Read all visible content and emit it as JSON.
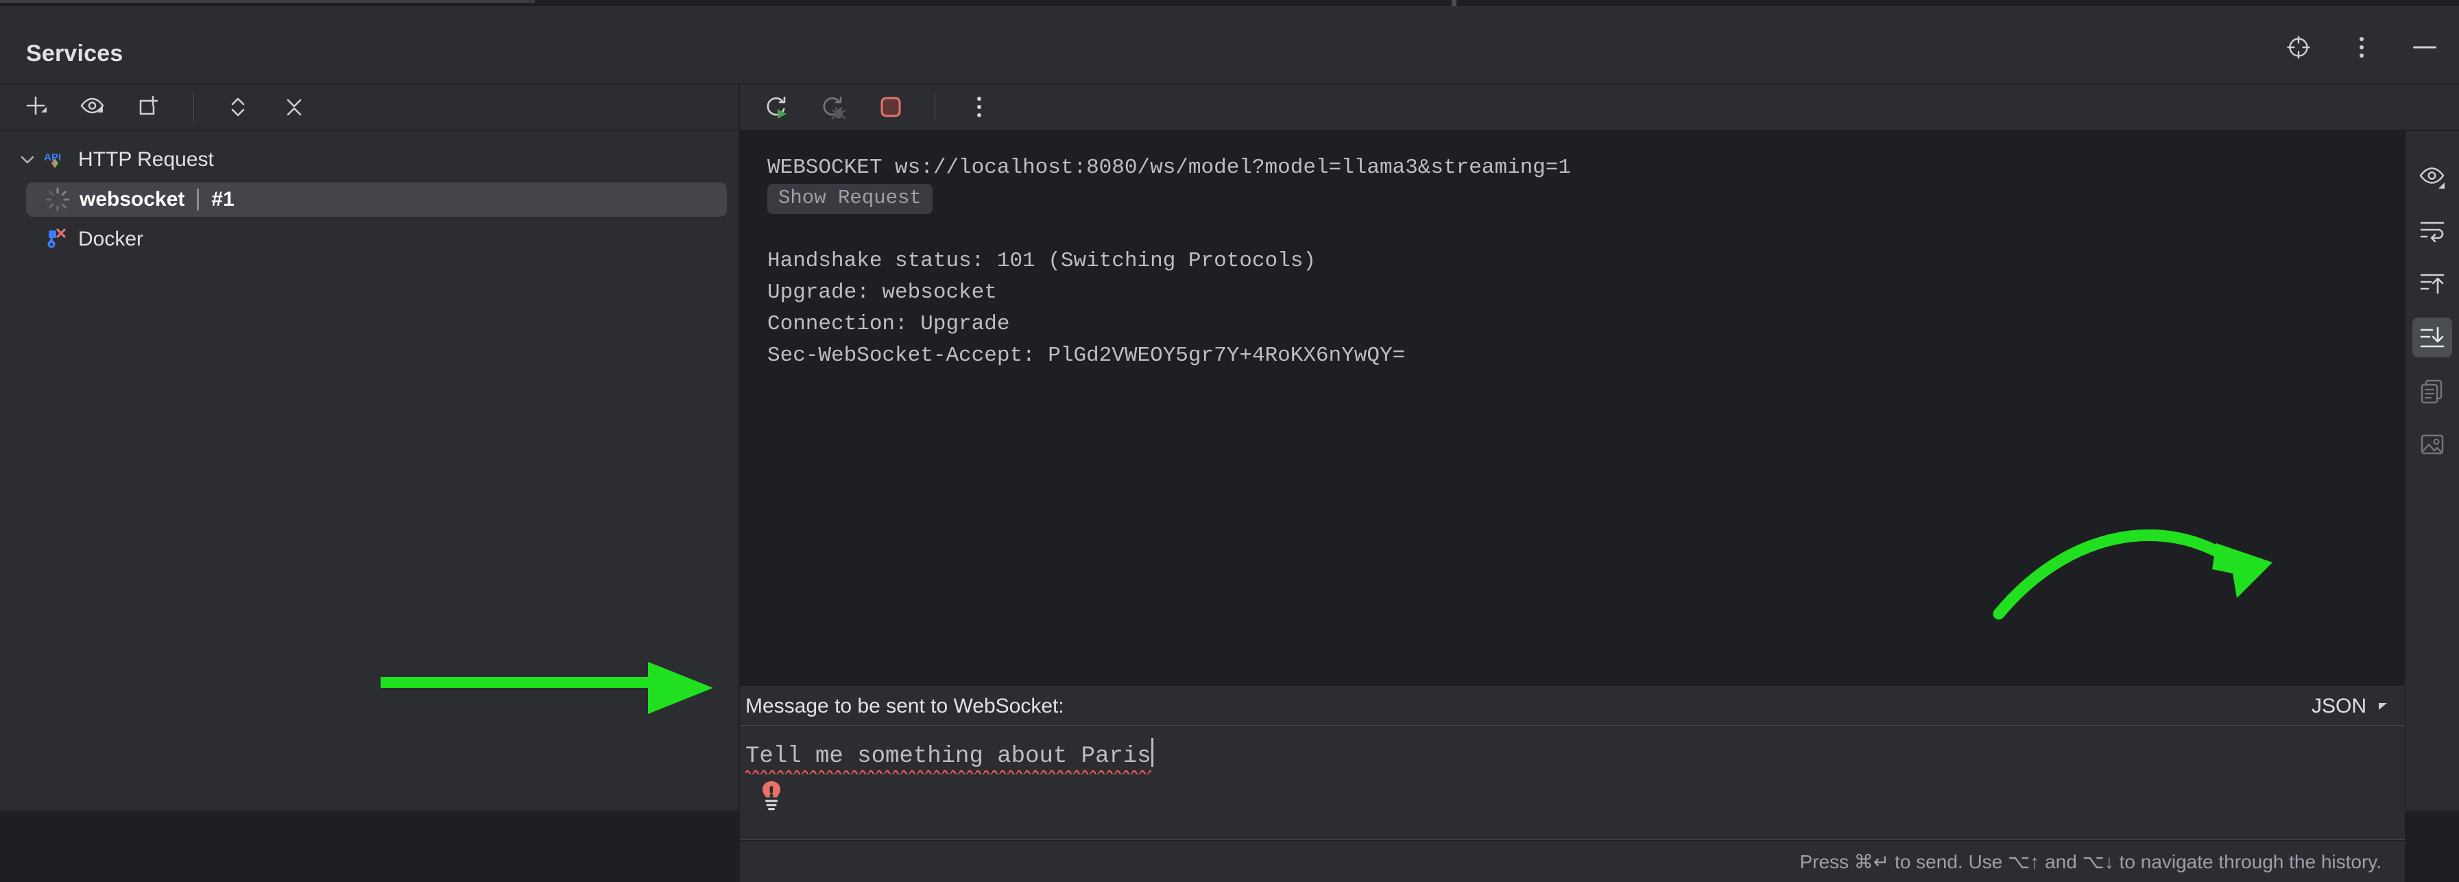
{
  "window": {
    "title": "Services",
    "actions": [
      {
        "name": "locate-icon",
        "label": "Locate"
      },
      {
        "name": "more-options-icon",
        "label": "Options"
      },
      {
        "name": "minimize-icon",
        "label": "Hide"
      }
    ]
  },
  "left_toolbar": {
    "buttons": [
      {
        "name": "add-icon",
        "label": "Add"
      },
      {
        "name": "eye-icon",
        "label": "Show/Hide"
      },
      {
        "name": "new-tab-icon",
        "label": "Add Tab"
      },
      {
        "name": "expand-all-icon",
        "label": "Expand All"
      },
      {
        "name": "collapse-all-icon",
        "label": "Collapse All"
      }
    ]
  },
  "tree": {
    "nodes": [
      {
        "label": "HTTP Request",
        "icon": "api-icon",
        "expanded": true,
        "selected": false
      },
      {
        "label": "websocket",
        "badge": "#1",
        "icon": "spinner-icon",
        "selected": true
      },
      {
        "label": "Docker",
        "icon": "docker-disconnected-icon",
        "selected": false
      }
    ]
  },
  "content_toolbar": {
    "buttons": [
      {
        "name": "rerun-icon",
        "label": "Rerun",
        "enabled": true
      },
      {
        "name": "rerun-debug-icon",
        "label": "Rerun with Debugger",
        "enabled": false
      },
      {
        "name": "stop-icon",
        "label": "Stop",
        "enabled": true
      },
      {
        "name": "more-options-icon",
        "label": "More",
        "enabled": true
      }
    ]
  },
  "console": {
    "request_line": "WEBSOCKET ws://localhost:8080/ws/model?model=llama3&streaming=1",
    "show_request_label": "Show Request",
    "handshake": "Handshake status: 101 (Switching Protocols)",
    "upgrade": "Upgrade: websocket",
    "connection": "Connection: Upgrade",
    "accept": "Sec-WebSocket-Accept: PlGd2VWEOY5gr7Y+4RoKX6nYwQY="
  },
  "gutter": {
    "buttons": [
      {
        "name": "eye-icon",
        "label": "Console View Options",
        "state": "normal"
      },
      {
        "name": "soft-wrap-icon",
        "label": "Soft-Wrap",
        "state": "normal"
      },
      {
        "name": "scroll-to-top-icon",
        "label": "Scroll to Top",
        "state": "normal"
      },
      {
        "name": "scroll-to-end-icon",
        "label": "Scroll to End",
        "state": "active"
      },
      {
        "name": "copy-icon",
        "label": "Copy",
        "state": "dim"
      },
      {
        "name": "export-image-icon",
        "label": "Export",
        "state": "dim"
      }
    ]
  },
  "message": {
    "label": "Message to be sent to WebSocket:",
    "language": "JSON",
    "value": "Tell me something about Paris",
    "status_hint": "Press ⌘↵ to send. Use ⌥↑ and ⌥↓ to navigate through the history.",
    "intention_icon": "error-bulb-icon"
  },
  "annotations": {
    "color": "#20E020",
    "items": [
      {
        "name": "arrow-to-message-input",
        "shape": "straight"
      },
      {
        "name": "arrow-to-language-selector",
        "shape": "curved"
      }
    ]
  },
  "colors": {
    "panel_bg": "#2b2d30",
    "console_bg": "#1e1f22",
    "selection_bg": "#43454a",
    "text": "#dfe1e5",
    "mono_text": "#bcbec4",
    "accent_green": "#20E020",
    "error_red": "#f05a5a"
  }
}
